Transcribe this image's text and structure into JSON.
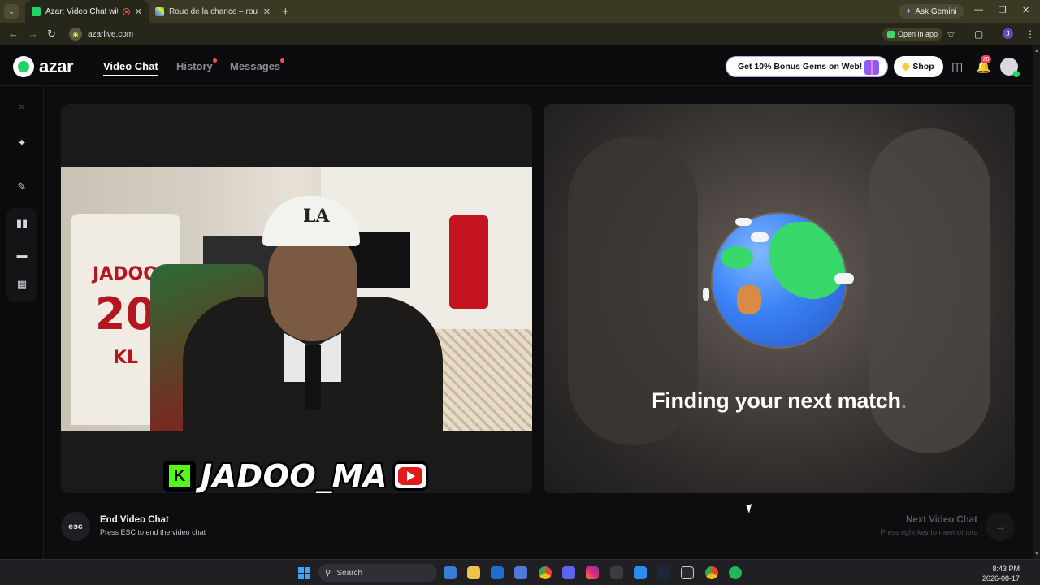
{
  "browser": {
    "tabs": [
      {
        "title": "Azar: Video Chat with New",
        "active": true
      },
      {
        "title": "Roue de la chance – roue aléato",
        "active": false
      }
    ],
    "ask_gemini": "Ask Gemini",
    "url": "azarlive.com",
    "open_in_app": "Open in app",
    "profile_initial": "J"
  },
  "header": {
    "logo_text": "azar",
    "nav": [
      {
        "label": "Video Chat",
        "active": true
      },
      {
        "label": "History",
        "dot": true
      },
      {
        "label": "Messages",
        "dot": true
      }
    ],
    "bonus_label": "Get 10% Bonus Gems on Web!",
    "shop_label": "Shop",
    "notification_count": "20"
  },
  "left_panel": {
    "overlay_name": "JADOO_MA",
    "kick_letter": "K",
    "jersey_name": "JADOO",
    "jersey_number": "20",
    "jersey_initials": "KL",
    "cap_logo": "LA"
  },
  "right_panel": {
    "status_text": "Finding your next match",
    "status_dot": "."
  },
  "controls": {
    "esc_label": "esc",
    "end_title": "End Video Chat",
    "end_sub": "Press ESC to end the video chat",
    "next_title": "Next Video Chat",
    "next_sub": "Press right key to meet others"
  },
  "taskbar": {
    "search_label": "Search",
    "time": "8:43 PM",
    "date": "2026-08-17"
  },
  "colors": {
    "accent_green": "#24d366",
    "notification_red": "#ff3b5c",
    "background": "#0d0d0f"
  }
}
